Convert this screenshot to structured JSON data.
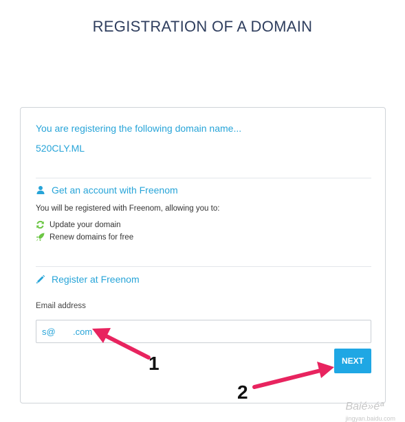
{
  "page_title": "REGISTRATION OF A DOMAIN",
  "intro_text": "You are registering the following domain name...",
  "domain_name": "520CLY.ML",
  "account_section": {
    "heading": "Get an account with Freenom",
    "icon": "user-icon",
    "description": "You will be registered with Freenom, allowing you to:",
    "benefits": [
      {
        "label": "Update your domain",
        "icon": "refresh-icon"
      },
      {
        "label": "Renew domains for free",
        "icon": "rocket-icon"
      }
    ]
  },
  "register_section": {
    "heading": "Register at Freenom",
    "icon": "pencil-icon",
    "email_label": "Email address",
    "email_value": "s@       .com"
  },
  "next_label": "NEXT",
  "annotations": [
    "1",
    "2"
  ],
  "watermark": "Baié»éª",
  "watermark_sub": "jingyan.baidu.com",
  "colors": {
    "accent": "#27a4d8",
    "button": "#1fa7e4",
    "title": "#2f3e5e",
    "annotation": "#e8245f",
    "icon_green": "#6cc644"
  }
}
